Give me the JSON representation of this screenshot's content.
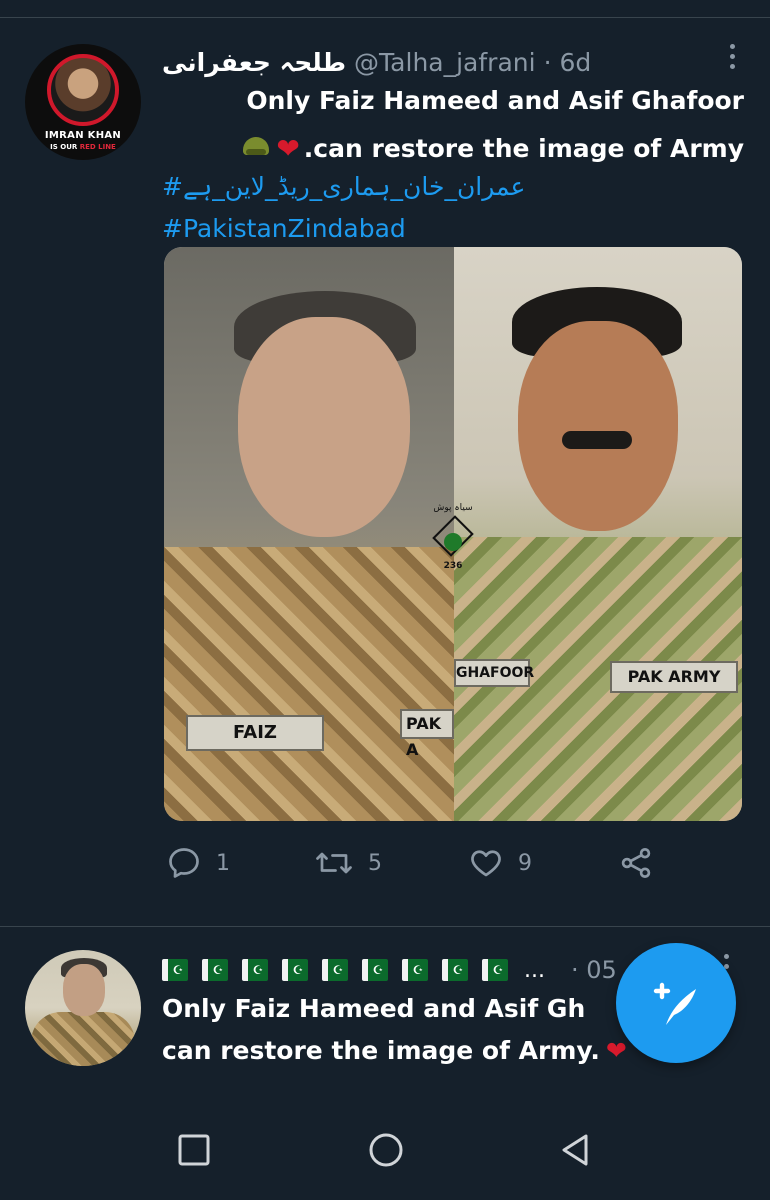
{
  "tweet1": {
    "author_name": "طلحہ جعفرانی",
    "handle": "@Talha_jafrani",
    "timestamp": "6d",
    "avatar_caption_line1": "IMRAN KHAN",
    "avatar_caption_line2_start": "IS OUR",
    "avatar_caption_line2_accent": "RED LINE",
    "text_line1": "Only Faiz Hameed and Asif Ghafoor",
    "text_line2": ".can restore the image of Army",
    "emoji": [
      "military-helmet",
      "red-heart"
    ],
    "hashtags": [
      "#عمران_خان_ہماری_ریڈ_لاین_ہے",
      "#PakistanZindabad"
    ],
    "media": {
      "name_tag_left": "FAIZ",
      "army_tag_left": "PAK A",
      "name_tag_right": "GHAFOOR",
      "army_tag_right": "PAK ARMY",
      "watermark_top": "سیاہ پوش",
      "watermark_bottom": "236"
    },
    "actions": {
      "reply_count": "1",
      "retweet_count": "5",
      "like_count": "9"
    }
  },
  "tweet2": {
    "author_flags": "🇵🇰🇵🇰🇵🇰🇵🇰🇵🇰🇵🇰🇵🇰🇵🇰🇵🇰",
    "ellipsis": "...",
    "timestamp_partial": "· 05",
    "text_line1": "Only Faiz Hameed and Asif Gh",
    "text_line2": "can restore the image of Army."
  },
  "colors": {
    "background": "#15202b",
    "accent": "#1d9bf0",
    "secondary_text": "#8b98a5",
    "divider": "#38444d",
    "heart": "#d71a2c"
  },
  "icons": {
    "reply": "reply-icon",
    "retweet": "retweet-icon",
    "like": "like-icon",
    "share": "share-icon",
    "compose": "compose-tweet-icon",
    "nav_back": "back-triangle-icon",
    "nav_home": "home-circle-icon",
    "nav_recent": "recent-apps-square-icon"
  }
}
